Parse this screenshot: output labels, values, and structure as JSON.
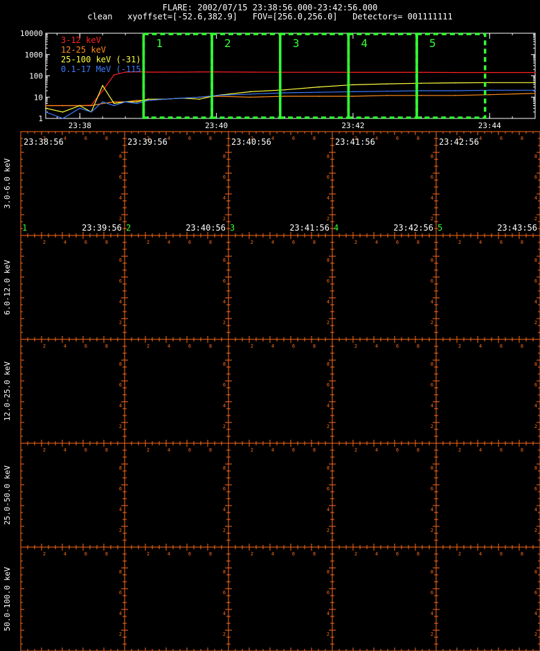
{
  "header": {
    "line1": "FLARE: 2002/07/15 23:38:56.000-23:42:56.000",
    "line2": "clean   xyoffset=[-52.6,382.9]   FOV=[256.0,256.0]   Detectors= 001111111"
  },
  "colors": {
    "background": "#000000",
    "axes": "#ffffff",
    "grid_orange": "#ff6a1a",
    "interval_green": "#33ff33",
    "panel_label_green": "#33ff33"
  },
  "chart_data": [
    {
      "type": "line",
      "title": "",
      "xlabel": "",
      "ylabel": "",
      "yscale": "log",
      "ylim": [
        1,
        10000
      ],
      "xlim": [
        "23:37:30",
        "23:44:40"
      ],
      "x_tick_labels": [
        "23:38",
        "23:40",
        "23:42",
        "23:44"
      ],
      "y_tick_labels": [
        "1",
        "10",
        "100",
        "1000",
        "10000"
      ],
      "legend_placement": "top-left",
      "x": [
        "23:37:30",
        "23:37:45",
        "23:38:00",
        "23:38:10",
        "23:38:20",
        "23:38:30",
        "23:38:40",
        "23:38:50",
        "23:39:00",
        "23:39:15",
        "23:39:30",
        "23:39:45",
        "23:40:00",
        "23:40:30",
        "23:41:00",
        "23:41:30",
        "23:42:00",
        "23:42:30",
        "23:43:00",
        "23:43:30",
        "23:44:00",
        "23:44:40"
      ],
      "series": [
        {
          "name": "3-12 keV",
          "color": "#ff2020",
          "values": [
            4,
            4,
            4,
            4.2,
            20,
            110,
            150,
            155,
            150,
            150,
            150,
            152,
            152,
            150,
            148,
            148,
            146,
            146,
            146,
            144,
            144,
            144
          ]
        },
        {
          "name": "12-25 keV",
          "color": "#ff8c1a",
          "values": [
            4,
            4,
            4,
            4,
            5,
            6,
            6,
            7,
            7,
            8,
            9,
            10,
            11,
            10,
            11,
            11,
            11,
            12,
            12,
            12,
            13,
            15
          ]
        },
        {
          "name": "25-100 keV (-31)",
          "color": "#ffff40",
          "values": [
            3,
            2,
            4,
            2,
            35,
            5,
            6,
            6,
            8,
            8,
            9,
            8,
            12,
            18,
            22,
            30,
            38,
            42,
            45,
            47,
            48,
            48
          ]
        },
        {
          "name": "0.1-17 MeV (-115)",
          "color": "#3a7bff",
          "values": [
            2,
            1,
            3,
            2,
            6,
            4,
            6,
            5,
            7,
            8,
            9,
            10,
            12,
            14,
            16,
            17,
            18,
            19,
            20,
            20,
            21,
            21
          ]
        }
      ],
      "intervals": [
        {
          "label": "1",
          "start": "23:38:56",
          "end": "23:39:56"
        },
        {
          "label": "2",
          "start": "23:39:56",
          "end": "23:40:56"
        },
        {
          "label": "3",
          "start": "23:40:56",
          "end": "23:41:56"
        },
        {
          "label": "4",
          "start": "23:41:56",
          "end": "23:42:56"
        },
        {
          "label": "5",
          "start": "23:42:56",
          "end": "23:43:56"
        }
      ]
    },
    {
      "type": "heatmap",
      "title": "",
      "rows": [
        "3.0-6.0 keV",
        "6.0-12.0 keV",
        "12.0-25.0 keV",
        "25.0-50.0 keV",
        "50.0-100.0 keV"
      ],
      "columns": [
        {
          "index": "1",
          "start": "23:38:56",
          "end": "23:39:56"
        },
        {
          "index": "2",
          "start": "23:39:56",
          "end": "23:40:56"
        },
        {
          "index": "3",
          "start": "23:40:56",
          "end": "23:41:56"
        },
        {
          "index": "4",
          "start": "23:41:56",
          "end": "23:42:56"
        },
        {
          "index": "5",
          "start": "23:42:56",
          "end": "23:43:56"
        }
      ],
      "axis_tick_labels": [
        "2",
        "4",
        "6",
        "8"
      ]
    }
  ]
}
